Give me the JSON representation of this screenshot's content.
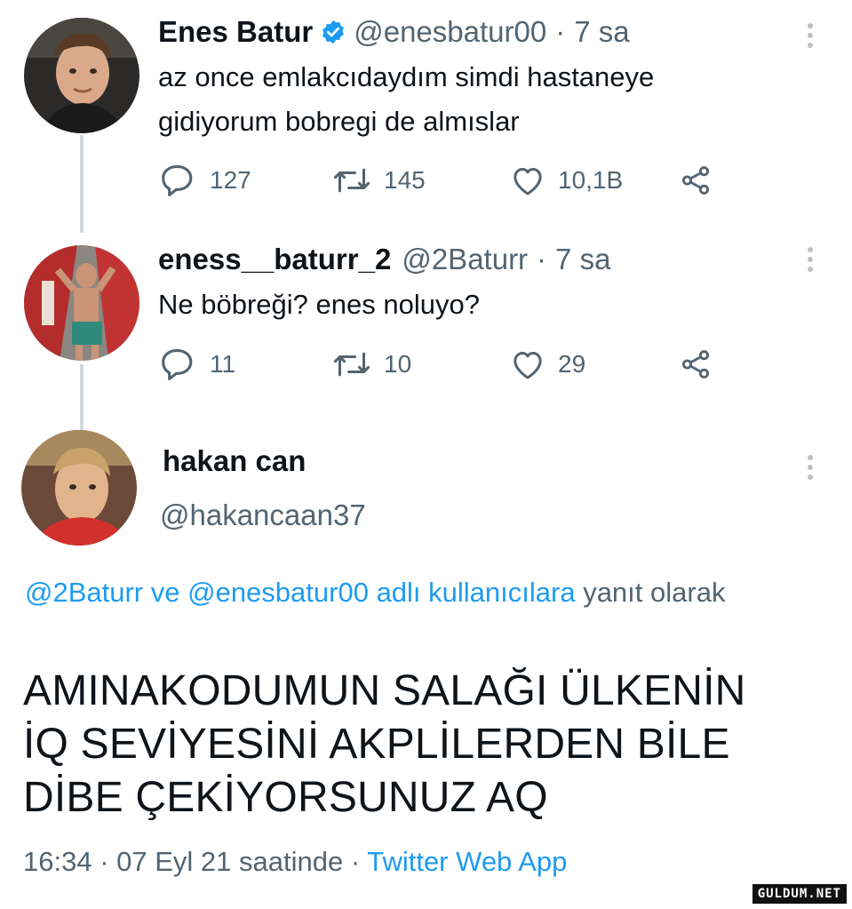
{
  "tweets": [
    {
      "name": "Enes Batur",
      "handle": "@enesbatur00",
      "separator": "·",
      "time": "7 sa",
      "verified": true,
      "text_lines": [
        "az once emlakcıdaydım simdi hastaneye",
        "gidiyorum bobregi de almıslar"
      ],
      "replies": "127",
      "retweets": "145",
      "likes": "10,1B"
    },
    {
      "name": "eness__baturr_2",
      "handle": "@2Baturr",
      "separator": "·",
      "time": "7 sa",
      "verified": false,
      "text_lines": [
        "Ne böbreği? enes noluyo?"
      ],
      "replies": "11",
      "retweets": "10",
      "likes": "29"
    }
  ],
  "focused": {
    "name": "hakan can",
    "handle": "@hakancaan37",
    "reply_to": {
      "mention1": "@2Baturr",
      "conj": " ve ",
      "mention2": "@enesbatur00",
      "linked_tail": " adlı kullanıcılara",
      "tail": " yanıt olarak"
    },
    "text_lines": [
      "AMINAKODUMUN SALAĞI ÜLKENİN",
      "İQ SEVİYESİNİ AKPLİLERDEN BİLE",
      "DİBE ÇEKİYORSUNUZ AQ"
    ],
    "time": "16:34",
    "sep": " · ",
    "date": "07 Eyl 21 saatinde",
    "sep2": " · ",
    "source": "Twitter Web App"
  },
  "icons": {
    "reply": "reply-icon",
    "retweet": "retweet-icon",
    "like": "heart-icon",
    "share": "share-icon",
    "verified": "verified-badge-icon",
    "more": "more-vertical-icon"
  },
  "colors": {
    "link": "#1d9bf0",
    "muted": "#536471",
    "text": "#0f1419",
    "verified": "#1d9bf0"
  },
  "watermark": "GULDUM.NET"
}
